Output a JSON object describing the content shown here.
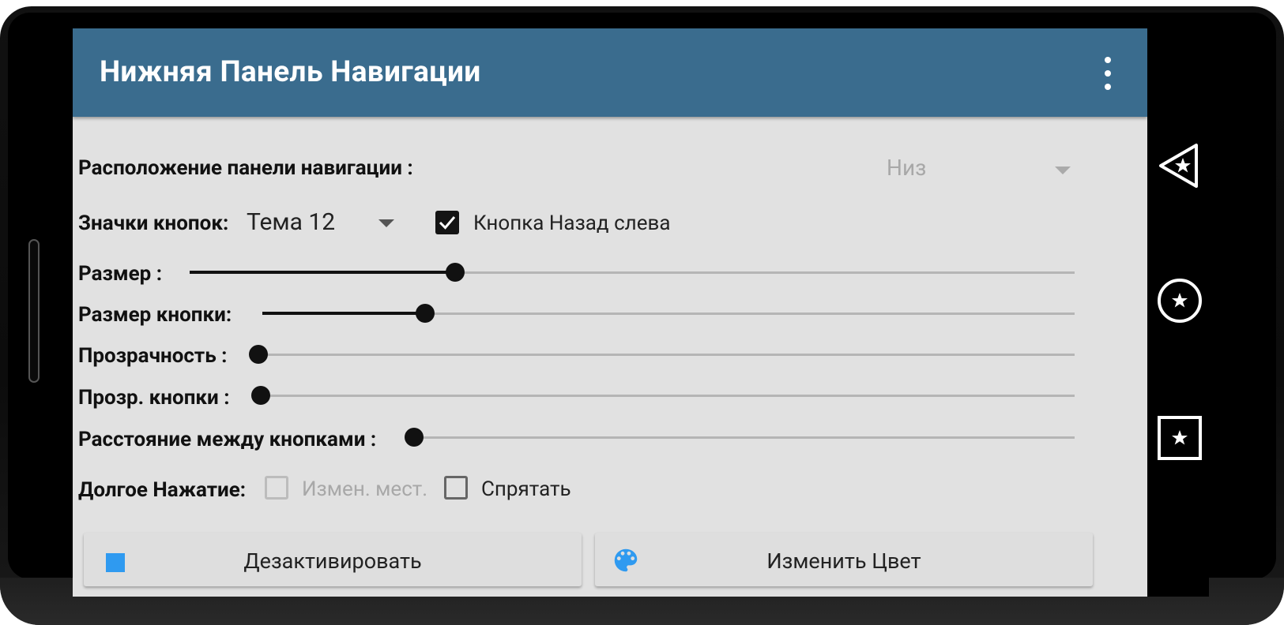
{
  "app_bar": {
    "title": "Нижняя Панель Навигации",
    "menu_icon": "overflow-menu-icon",
    "color": "#3a6c8e"
  },
  "position": {
    "label": "Расположение панели навигации :",
    "value": "Низ"
  },
  "icons_row": {
    "label": "Значки кнопок:",
    "theme": "Тема 12",
    "back_left_label": "Кнопка Назад слева",
    "back_left_checked": true
  },
  "sliders": [
    {
      "label": "Размер :",
      "level_percent": 30
    },
    {
      "label": "Размер кнопки:",
      "level_percent": 20
    },
    {
      "label": "Прозрачность :",
      "level_percent": 0
    },
    {
      "label": "Прозр. кнопки :",
      "level_percent": 0
    },
    {
      "label": "Расстояние между кнопками :",
      "level_percent": 0
    }
  ],
  "long_press": {
    "label": "Долгое Нажатие:",
    "swap_label": "Измен. мест.",
    "swap_enabled": false,
    "hide_label": "Спрятать",
    "hide_checked": false
  },
  "buttons": {
    "deactivate_label": "Дезактивировать",
    "deactivate_icon_color": "#2f9af0",
    "change_color_label": "Изменить Цвет",
    "change_color_icon_color": "#2f9af0"
  },
  "navbar": {
    "back_icon": "back-star-triangle-icon",
    "home_icon": "home-star-circle-icon",
    "recents_icon": "recents-star-square-icon"
  }
}
